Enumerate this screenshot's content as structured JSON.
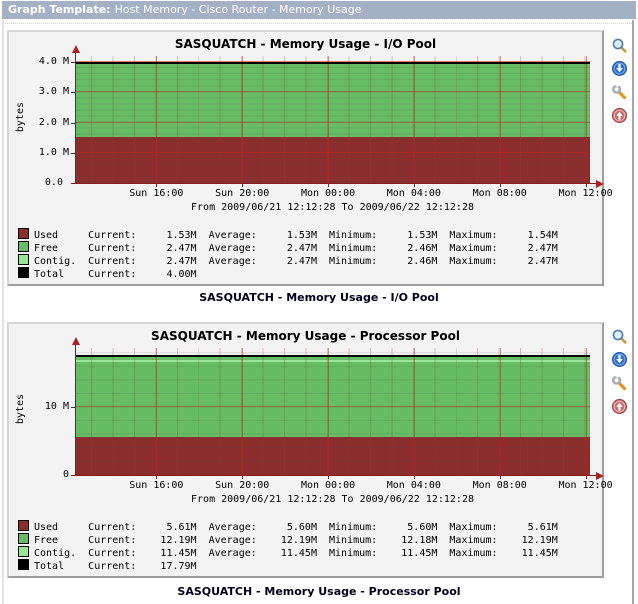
{
  "header": {
    "label": "Graph Template:",
    "value": "Host Memory - Cisco Router - Memory Usage",
    "bg_color": "#a4b1c4"
  },
  "icons": [
    "zoom-graph",
    "csv-export",
    "graph-source",
    "graph-utilities"
  ],
  "colors": {
    "panel_bg": "#f3f3f3",
    "used": "#8b2d2d",
    "free": "#66bd66",
    "contig": "#99e699",
    "total": "#000000",
    "grid_major": "rgba(205,30,25,0.5)",
    "axis_red": "#8c1a1a"
  },
  "chart_data": [
    {
      "type": "area",
      "title": "SASQUATCH - Memory Usage - I/O Pool",
      "caption": "SASQUATCH - Memory Usage - I/O Pool",
      "ylabel": "bytes",
      "period_label": "From 2009/06/21 12:12:28 To 2009/06/22 12:12:28",
      "x_ticks": [
        "Sun 16:00",
        "Sun 20:00",
        "Mon 00:00",
        "Mon 04:00",
        "Mon 08:00",
        "Mon 12:00"
      ],
      "y_ticks": [
        {
          "m": 0,
          "label": "0.0 "
        },
        {
          "m": 1,
          "label": "1.0 M"
        },
        {
          "m": 2,
          "label": "2.0 M"
        },
        {
          "m": 3,
          "label": "3.0 M"
        },
        {
          "m": 4,
          "label": "4.0 M"
        }
      ],
      "ylim_m": 4.2,
      "y_minor_step_m": 0.2,
      "legend_stat_keys": [
        "Current",
        "Average",
        "Minimum",
        "Maximum"
      ],
      "series": [
        {
          "name": "Used",
          "color": "#8b2d2d",
          "draw": "stack-area",
          "value_m": 1.53,
          "stats": {
            "Current": "1.53M",
            "Average": "1.53M",
            "Minimum": "1.53M",
            "Maximum": "1.54M"
          }
        },
        {
          "name": "Free",
          "color": "#66bd66",
          "draw": "stack-area",
          "value_m": 2.47,
          "stats": {
            "Current": "2.47M",
            "Average": "2.47M",
            "Minimum": "2.46M",
            "Maximum": "2.47M"
          }
        },
        {
          "name": "Contig.",
          "color": "#99e699",
          "draw": "stack-line",
          "value_m": 2.47,
          "stats": {
            "Current": "2.47M",
            "Average": "2.47M",
            "Minimum": "2.46M",
            "Maximum": "2.47M"
          }
        },
        {
          "name": "Total",
          "color": "#000000",
          "draw": "top-line",
          "value_m": 4.0,
          "stats": {
            "Current": "4.00M"
          }
        }
      ]
    },
    {
      "type": "area",
      "title": "SASQUATCH - Memory Usage - Processor Pool",
      "caption": "SASQUATCH - Memory Usage - Processor Pool",
      "ylabel": "bytes",
      "period_label": "From 2009/06/21 12:12:28 To 2009/06/22 12:12:28",
      "x_ticks": [
        "Sun 16:00",
        "Sun 20:00",
        "Mon 00:00",
        "Mon 04:00",
        "Mon 08:00",
        "Mon 12:00"
      ],
      "y_ticks": [
        {
          "m": 0,
          "label": "0"
        },
        {
          "m": 10,
          "label": "10 M"
        }
      ],
      "ylim_m": 18.8,
      "y_minor_step_m": 2,
      "legend_stat_keys": [
        "Current",
        "Average",
        "Minimum",
        "Maximum"
      ],
      "series": [
        {
          "name": "Used",
          "color": "#8b2d2d",
          "draw": "stack-area",
          "value_m": 5.61,
          "stats": {
            "Current": "5.61M",
            "Average": "5.60M",
            "Minimum": "5.60M",
            "Maximum": "5.61M"
          }
        },
        {
          "name": "Free",
          "color": "#66bd66",
          "draw": "stack-area",
          "value_m": 12.19,
          "stats": {
            "Current": "12.19M",
            "Average": "12.19M",
            "Minimum": "12.18M",
            "Maximum": "12.19M"
          }
        },
        {
          "name": "Contig.",
          "color": "#99e699",
          "draw": "stack-line",
          "value_m": 11.45,
          "stats": {
            "Current": "11.45M",
            "Average": "11.45M",
            "Minimum": "11.45M",
            "Maximum": "11.45M"
          }
        },
        {
          "name": "Total",
          "color": "#000000",
          "draw": "top-line",
          "value_m": 17.79,
          "stats": {
            "Current": "17.79M"
          }
        }
      ]
    }
  ]
}
